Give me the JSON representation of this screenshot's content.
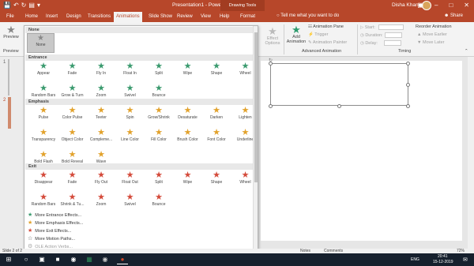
{
  "colors": {
    "accent": "#b7472a",
    "entrance": "#3a9a6e",
    "emphasis": "#e2a22c",
    "exit": "#d44a3a",
    "motion": "#555555"
  },
  "titlebar": {
    "title": "Presentation1 - PowerPoint",
    "context_tab": "Drawing Tools",
    "user": "Disha Khanie"
  },
  "tabs": [
    "File",
    "Home",
    "Insert",
    "Design",
    "Transitions",
    "Animations",
    "Slide Show",
    "Review",
    "View",
    "Help",
    "Format"
  ],
  "active_tab": "Animations",
  "tell_me": "Tell me what you want to do",
  "share": "Share",
  "ribbon": {
    "preview": "Preview",
    "preview_group": "Preview",
    "effect_options": "Effect Options",
    "add_animation": "Add Animation",
    "animation_pane": "Animation Pane",
    "trigger": "Trigger",
    "animation_painter": "Animation Painter",
    "advanced_group": "Advanced Animation",
    "start": "Start:",
    "duration": "Duration:",
    "delay": "Delay:",
    "reorder": "Reorder Animation",
    "move_earlier": "Move Earlier",
    "move_later": "Move Later",
    "timing_group": "Timing"
  },
  "gallery": {
    "none_header": "None",
    "none_label": "None",
    "entrance_header": "Entrance",
    "entrance": [
      "Appear",
      "Fade",
      "Fly In",
      "Float In",
      "Split",
      "Wipe",
      "Shape",
      "Wheel",
      "Random Bars",
      "Grow & Turn",
      "Zoom",
      "Swivel",
      "Bounce"
    ],
    "emphasis_header": "Emphasis",
    "emphasis": [
      "Pulse",
      "Color Pulse",
      "Teeter",
      "Spin",
      "Grow/Shrink",
      "Desaturate",
      "Darken",
      "Lighten",
      "Transparency",
      "Object Color",
      "Compleme...",
      "Line Color",
      "Fill Color",
      "Brush Color",
      "Font Color",
      "Underline",
      "Bold Flash",
      "Bold Reveal",
      "Wave"
    ],
    "exit_header": "Exit",
    "exit": [
      "Disappear",
      "Fade",
      "Fly Out",
      "Float Out",
      "Split",
      "Wipe",
      "Shape",
      "Wheel",
      "Random Bars",
      "Shrink & Tu...",
      "Zoom",
      "Swivel",
      "Bounce"
    ],
    "more": [
      "More Entrance Effects...",
      "More Emphasis Effects...",
      "More Exit Effects...",
      "More Motion Paths...",
      "OLE Action Verbs..."
    ]
  },
  "slides": {
    "num1": "1",
    "num2": "2"
  },
  "status": {
    "slide": "Slide 2 of 2",
    "notes": "Notes",
    "comments": "Comments",
    "zoom": "72%"
  },
  "taskbar": {
    "time": "20:41",
    "date": "15-12-2019",
    "lang": "ENG"
  }
}
